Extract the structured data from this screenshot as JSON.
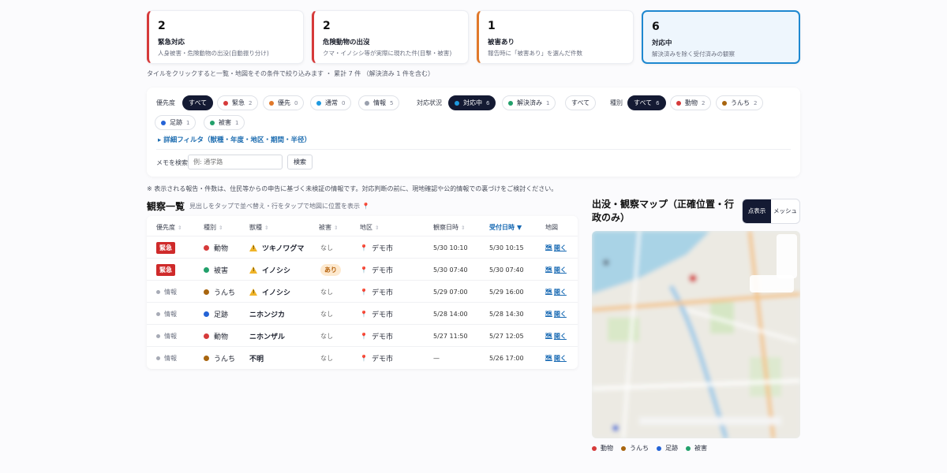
{
  "tiles": [
    {
      "num": "2",
      "title": "緊急対応",
      "sub": "人身被害・危険動物の出没(自動振り分け)"
    },
    {
      "num": "2",
      "title": "危険動物の出沒",
      "sub": "クマ・イノシシ等が実際に現れた件(目撃・被害)"
    },
    {
      "num": "1",
      "title": "被害あり",
      "sub": "報告時に「被害あり」を選んだ件数"
    },
    {
      "num": "6",
      "title": "対応中",
      "sub": "解決済みを除く受付済みの観察"
    }
  ],
  "hint": "タイルをクリックすると一覧・地図をその条件で絞り込みます ・ 累計 7 件 （解決済み 1 件を含む）",
  "filters": {
    "priority_label": "優先度",
    "priority": [
      {
        "label": "すべて",
        "count": "",
        "on": true,
        "color": ""
      },
      {
        "label": "緊急",
        "count": "2",
        "on": false,
        "color": "#d63a3a"
      },
      {
        "label": "優先",
        "count": "0",
        "on": false,
        "color": "#e0782a"
      },
      {
        "label": "通常",
        "count": "0",
        "on": false,
        "color": "#1e9ae0"
      },
      {
        "label": "情報",
        "count": "5",
        "on": false,
        "color": "#9aa0ad"
      }
    ],
    "status_label": "対応状況",
    "status": [
      {
        "label": "対応中",
        "count": "6",
        "on": true,
        "color": "#1e9ae0"
      },
      {
        "label": "解決済み",
        "count": "1",
        "on": false,
        "color": "#22a06b"
      },
      {
        "label": "すべて",
        "count": "",
        "on": false,
        "color": ""
      }
    ],
    "kind_label": "種別",
    "kind": [
      {
        "label": "すべて",
        "count": "6",
        "on": true,
        "color": ""
      },
      {
        "label": "動物",
        "count": "2",
        "on": false,
        "color": "#d63a3a"
      },
      {
        "label": "うんち",
        "count": "2",
        "on": false,
        "color": "#a8650f"
      },
      {
        "label": "足跡",
        "count": "1",
        "on": false,
        "color": "#2463d6"
      },
      {
        "label": "被害",
        "count": "1",
        "on": false,
        "color": "#22a06b"
      }
    ],
    "detail_link": "▸ 詳細フィルタ（獣種・年度・地区・期間・半径）",
    "memo_label": "メモを検索",
    "memo_placeholder": "例: 通学路",
    "search_button": "検索"
  },
  "notice": "※ 表示される報告・件数は、住民等からの申告に基づく未検証の情報です。対応判断の前に、現地確認や公的情報での裏づけをご検討ください。",
  "list": {
    "title": "観察一覧",
    "subtitle": "見出しをタップで並べ替え・行をタップで地図に位置を表示 📍",
    "headers": [
      "優先度",
      "種別",
      "獣種",
      "被害",
      "地区",
      "観察日時",
      "受付日時",
      "地図"
    ],
    "rows": [
      {
        "priority": "緊急",
        "kind": "動物",
        "kind_color": "#d63a3a",
        "species": "ツキノワグマ",
        "warn": true,
        "damage": "なし",
        "area": "デモ市",
        "observed": "5/30 10:10",
        "received": "5/30 10:15",
        "map": "開く"
      },
      {
        "priority": "緊急",
        "kind": "被害",
        "kind_color": "#22a06b",
        "species": "イノシシ",
        "warn": true,
        "damage": "あり",
        "area": "デモ市",
        "observed": "5/30 07:40",
        "received": "5/30 07:40",
        "map": "開く"
      },
      {
        "priority": "情報",
        "kind": "うんち",
        "kind_color": "#a8650f",
        "species": "イノシシ",
        "warn": true,
        "damage": "なし",
        "area": "デモ市",
        "observed": "5/29 07:00",
        "received": "5/29 16:00",
        "map": "開く"
      },
      {
        "priority": "情報",
        "kind": "足跡",
        "kind_color": "#2463d6",
        "species": "ニホンジカ",
        "warn": false,
        "damage": "なし",
        "area": "デモ市",
        "observed": "5/28 14:00",
        "received": "5/28 14:30",
        "map": "開く"
      },
      {
        "priority": "情報",
        "kind": "動物",
        "kind_color": "#d63a3a",
        "species": "ニホンザル",
        "warn": false,
        "damage": "なし",
        "area": "デモ市",
        "observed": "5/27 11:50",
        "received": "5/27 12:05",
        "map": "開く"
      },
      {
        "priority": "情報",
        "kind": "うんち",
        "kind_color": "#a8650f",
        "species": "不明",
        "warn": false,
        "damage": "なし",
        "area": "デモ市",
        "observed": "—",
        "received": "5/26 17:00",
        "map": "開く"
      }
    ]
  },
  "map": {
    "title": "出没・観察マップ（正確位置・行政のみ）",
    "toggle": [
      "点表示",
      "メッシュ"
    ],
    "legend": [
      {
        "label": "動物",
        "color": "#d63a3a"
      },
      {
        "label": "うんち",
        "color": "#a8650f"
      },
      {
        "label": "足跡",
        "color": "#2463d6"
      },
      {
        "label": "被害",
        "color": "#22a06b"
      }
    ]
  }
}
